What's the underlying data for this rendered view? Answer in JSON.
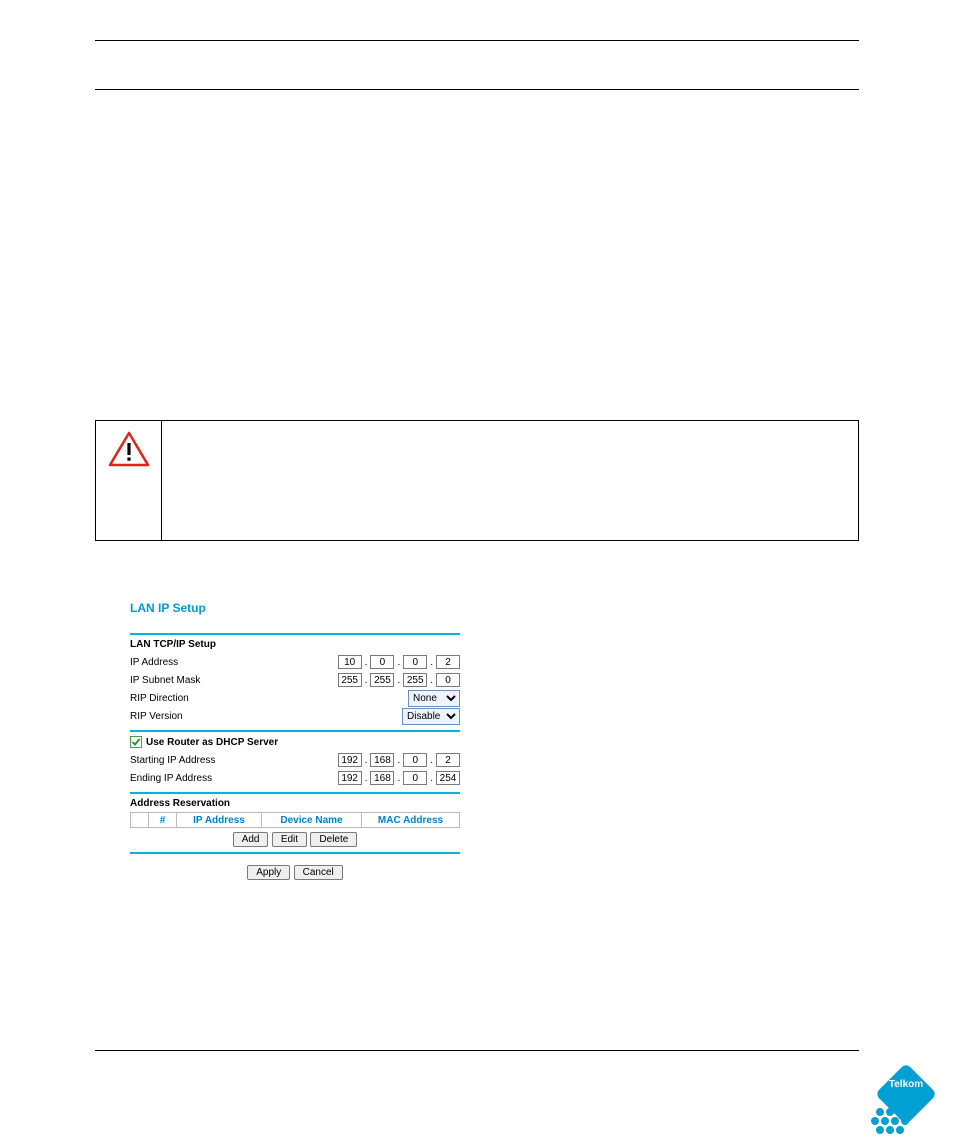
{
  "lan": {
    "title": "LAN IP Setup",
    "tcpip_head": "LAN TCP/IP Setup",
    "ip_label": "IP Address",
    "ip": {
      "a": "10",
      "b": "0",
      "c": "0",
      "d": "2"
    },
    "mask_label": "IP Subnet Mask",
    "mask": {
      "a": "255",
      "b": "255",
      "c": "255",
      "d": "0"
    },
    "rip_dir_label": "RIP Direction",
    "rip_dir": "None",
    "rip_ver_label": "RIP Version",
    "rip_ver": "Disable",
    "dhcp_label": "Use Router as DHCP Server",
    "start_label": "Starting IP Address",
    "start": {
      "a": "192",
      "b": "168",
      "c": "0",
      "d": "2"
    },
    "end_label": "Ending IP Address",
    "end": {
      "a": "192",
      "b": "168",
      "c": "0",
      "d": "254"
    },
    "res_head": "Address Reservation",
    "col_num": "#",
    "col_ip": "IP Address",
    "col_dev": "Device Name",
    "col_mac": "MAC Address",
    "btn_add": "Add",
    "btn_edit": "Edit",
    "btn_delete": "Delete",
    "btn_apply": "Apply",
    "btn_cancel": "Cancel"
  },
  "logo_text": "Telkom"
}
